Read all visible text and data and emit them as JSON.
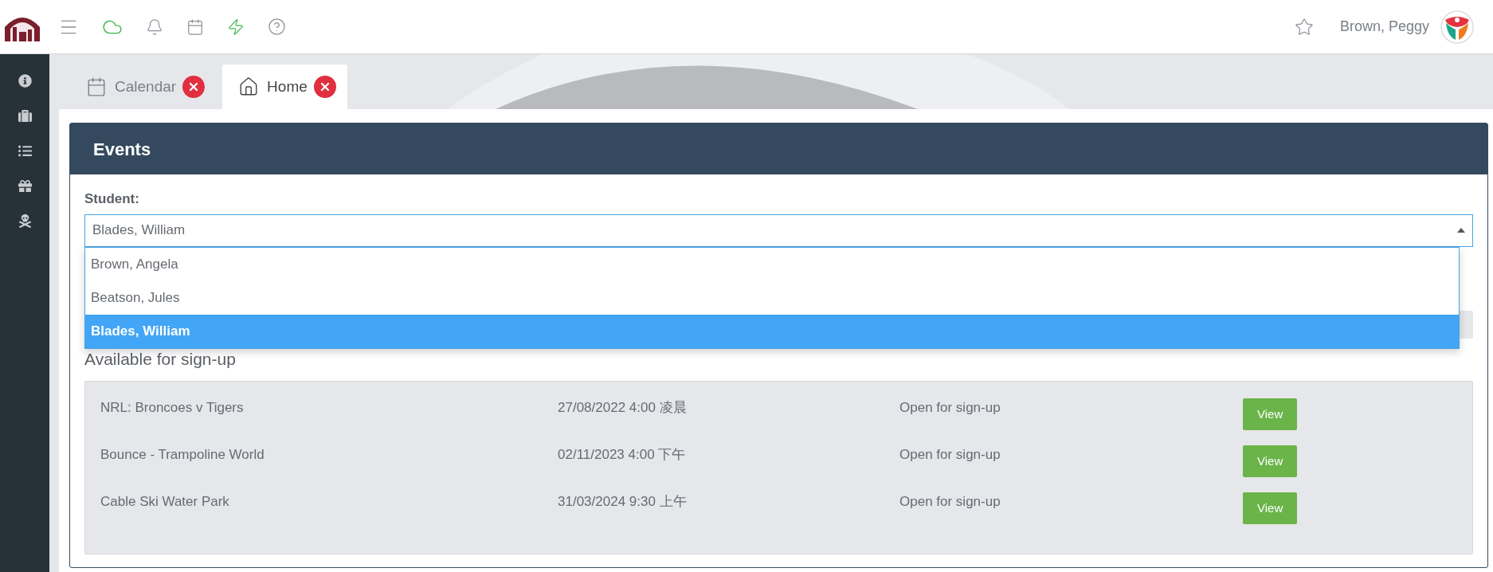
{
  "header": {
    "user_name": "Brown, Peggy"
  },
  "tabs": [
    {
      "label": "Calendar",
      "selected": false
    },
    {
      "label": "Home",
      "selected": true
    }
  ],
  "card": {
    "title": "Events",
    "student_field": {
      "label": "Student:",
      "value": "Blades, William",
      "expanded": true,
      "options": [
        {
          "label": "Brown, Angela",
          "selected": false
        },
        {
          "label": "Beatson, Jules",
          "selected": false
        },
        {
          "label": "Blades, William",
          "selected": true
        }
      ]
    },
    "section_title": "Available for sign-up",
    "events": [
      {
        "name": "NRL: Broncoes v Tigers",
        "date": "27/08/2022 4:00 凌晨",
        "status": "Open for sign-up",
        "button": "View"
      },
      {
        "name": "Bounce - Trampoline World",
        "date": "02/11/2023 4:00 下午",
        "status": "Open for sign-up",
        "button": "View"
      },
      {
        "name": "Cable Ski Water Park",
        "date": "31/03/2024 9:30 上午",
        "status": "Open for sign-up",
        "button": "View"
      }
    ]
  }
}
